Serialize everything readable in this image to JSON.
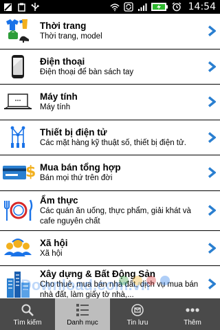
{
  "status_bar": {
    "time": "14:54",
    "icons": [
      "dota-icon",
      "clipboard-icon",
      "usb-icon",
      "wifi-icon",
      "sync-icon",
      "signal-icon",
      "battery-charging-icon",
      "alarm-icon"
    ]
  },
  "categories": [
    {
      "title": "Thời trang",
      "subtitle": "Thời trang, model",
      "icon": "clothing-icon"
    },
    {
      "title": "Điện thoại",
      "subtitle": "Điện thoại để bàn sách tay",
      "icon": "phone-icon"
    },
    {
      "title": "Máy tính",
      "subtitle": "Máy tính",
      "icon": "laptop-icon"
    },
    {
      "title": "Thiết bị điện tử",
      "subtitle": "Các mặt hàng kỹ thuật số, thiết bị điện tử.",
      "icon": "circuit-icon"
    },
    {
      "title": "Mua bán tổng hợp",
      "subtitle": "Bán mọi thứ trên đời",
      "icon": "money-card-icon"
    },
    {
      "title": "Ẩm thực",
      "subtitle": "Các quán ăn uống, thực phẩm, giải khát và cafe nguyên chất",
      "icon": "dining-icon"
    },
    {
      "title": "Xã hội",
      "subtitle": "Xã hội",
      "icon": "people-icon"
    },
    {
      "title": "Xây dựng & Bất Động Sản",
      "subtitle": "Cho thuê, mua bán nhà đất, dịch vụ mua bán nhà đất, làm giấy tờ nhà,...",
      "icon": "buildings-icon"
    }
  ],
  "watermark": "Download.com.vn",
  "tabs": [
    {
      "label": "Tìm kiếm",
      "icon": "search-icon",
      "active": false
    },
    {
      "label": "Danh mục",
      "icon": "grid-list-icon",
      "active": true
    },
    {
      "label": "Tin lưu",
      "icon": "saved-icon",
      "active": false
    },
    {
      "label": "Thêm",
      "icon": "more-icon",
      "active": false
    }
  ],
  "colors": {
    "accent": "#2a7fd0",
    "tabbar": "#4a4a4a",
    "tab_active": "#bdbdbd"
  }
}
